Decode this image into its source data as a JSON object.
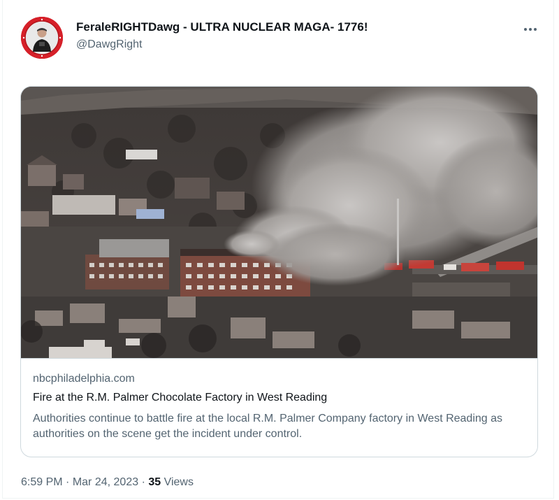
{
  "tweet": {
    "author": {
      "display_name": "FeraleRIGHTDawg - ULTRA NUCLEAR MAGA- 1776!",
      "handle": "@DawgRight"
    },
    "more_icon": "more-horizontal-icon",
    "link_card": {
      "domain": "nbcphiladelphia.com",
      "title": "Fire at the R.M. Palmer Chocolate Factory in West Reading",
      "description": "Authorities continue to battle fire at the local R.M. Palmer Company factory in West Reading as authorities on the scene get the incident under control."
    },
    "meta": {
      "time": "6:59 PM",
      "separator": "·",
      "date": "Mar 24, 2023",
      "views_count": "35",
      "views_label": "Views"
    }
  },
  "colors": {
    "text_primary": "#0f1419",
    "text_secondary": "#536471",
    "border": "#cfd9de",
    "avatar_ring": "#d8212a"
  }
}
